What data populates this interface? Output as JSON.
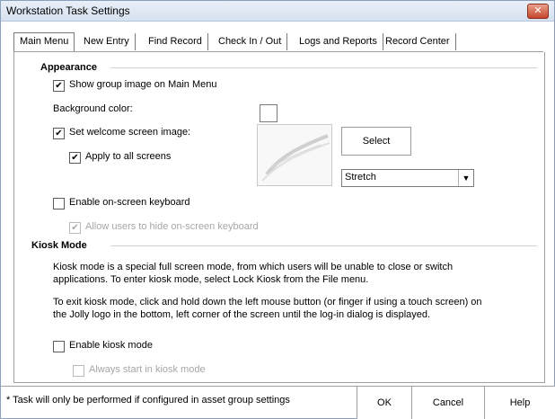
{
  "window": {
    "title": "Workstation Task Settings",
    "close_glyph": "✕"
  },
  "tabs": [
    {
      "label": "Main Menu"
    },
    {
      "label": "New Entry"
    },
    {
      "label": "Find Record"
    },
    {
      "label": "Check In / Out"
    },
    {
      "label": "Logs and Reports"
    },
    {
      "label": "Record Center"
    }
  ],
  "appearance": {
    "title": "Appearance",
    "show_group_image": {
      "label": "Show group image on Main Menu",
      "checked": true
    },
    "background_color_label": "Background color:",
    "set_welcome_image": {
      "label": "Set welcome screen image:",
      "checked": true
    },
    "apply_all_screens": {
      "label": "Apply to all screens",
      "checked": true
    },
    "select_button": "Select",
    "stretch_value": "Stretch",
    "enable_keyboard": {
      "label": "Enable on-screen keyboard",
      "checked": false
    },
    "allow_hide_keyboard": {
      "label": "Allow users to hide on-screen keyboard",
      "checked": true,
      "disabled": true
    }
  },
  "kiosk": {
    "title": "Kiosk Mode",
    "desc1": "Kiosk mode is a special full screen mode, from which users will be unable to close or switch",
    "desc2": "applications. To enter kiosk mode, select Lock Kiosk from the File menu.",
    "desc3": "To exit kiosk mode, click and hold down the left mouse button (or finger if using a touch screen) on",
    "desc4": "the Jolly logo in the bottom, left corner of the screen until the log-in dialog is displayed.",
    "enable": {
      "label": "Enable kiosk mode",
      "checked": false
    },
    "always_start": {
      "label": "Always start in kiosk mode",
      "checked": false,
      "disabled": true
    }
  },
  "footer": {
    "note": "* Task will only be performed if configured in asset group settings",
    "ok": "OK",
    "cancel": "Cancel",
    "help": "Help"
  }
}
